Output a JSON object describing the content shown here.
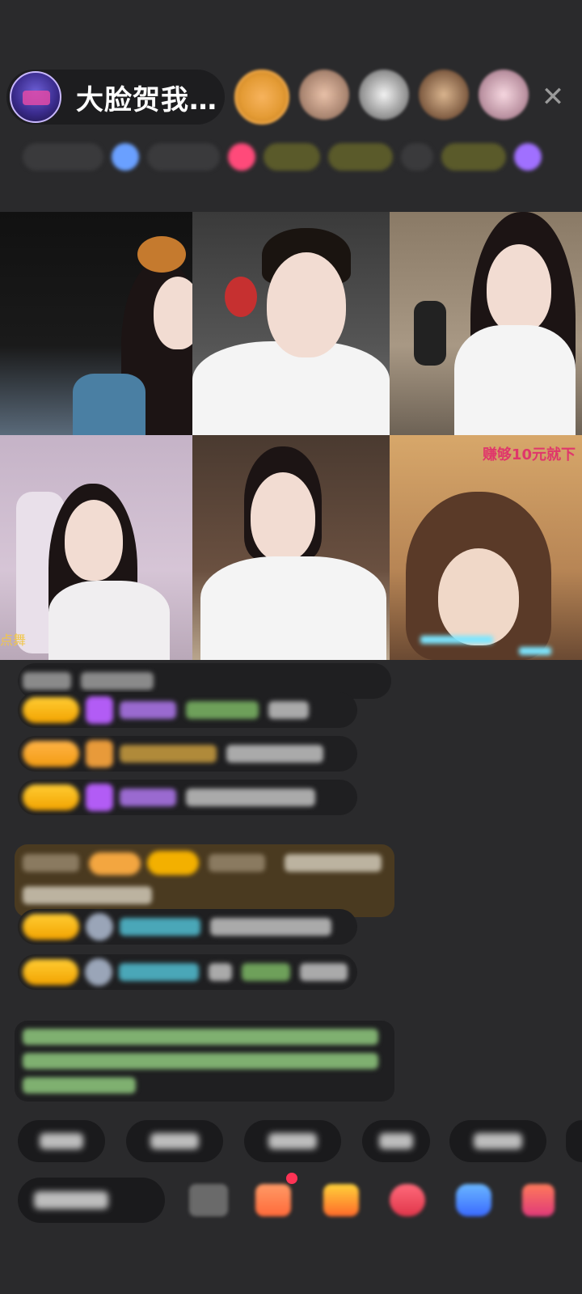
{
  "header": {
    "host_name": "大脸贺我…",
    "close_symbol": "✕"
  },
  "grid": {
    "tile_overlay_top_right": "赚够10元就下",
    "tile_overlay_left": "点舞"
  },
  "icons": {
    "close": "close-icon",
    "gift": "gift-icon",
    "store": "store-icon",
    "emoji": "emoji-icon"
  },
  "colors": {
    "background": "#2a2a2c",
    "badge_gold": "#f2a300",
    "overlay_red": "#e0366b",
    "notification_red": "#ff3355"
  }
}
